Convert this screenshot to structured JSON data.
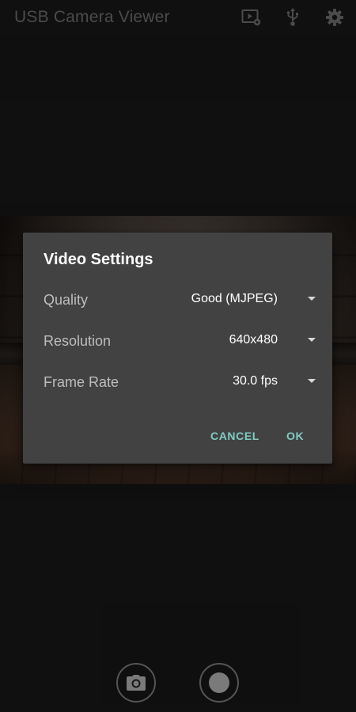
{
  "app": {
    "title": "USB Camera Viewer",
    "toolbar_icons": [
      "video-settings-icon",
      "usb-icon",
      "gear-icon"
    ]
  },
  "dialog": {
    "title": "Video Settings",
    "rows": [
      {
        "label": "Quality",
        "value": "Good (MJPEG)"
      },
      {
        "label": "Resolution",
        "value": "640x480"
      },
      {
        "label": "Frame Rate",
        "value": "30.0 fps"
      }
    ],
    "cancel_label": "CANCEL",
    "ok_label": "OK"
  },
  "controls": {
    "photo_icon": "camera-icon",
    "record_icon": "record-icon"
  },
  "colors": {
    "background": "#171717",
    "dialog_bg": "#424242",
    "accent": "#80cbc4",
    "title_text": "#6f6f6f"
  }
}
